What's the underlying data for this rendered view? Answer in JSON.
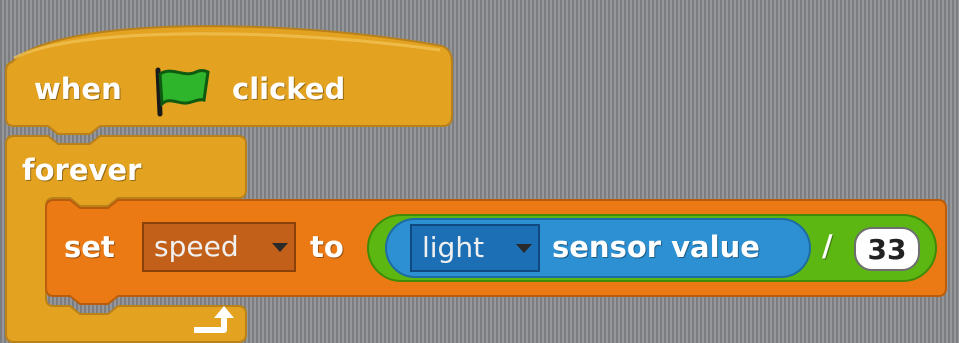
{
  "hat_block": {
    "prefix": "when",
    "icon": "green-flag-icon",
    "suffix": "clicked"
  },
  "forever_block": {
    "label": "forever",
    "loop_icon": "loop-arrow-icon"
  },
  "set_block": {
    "keyword": "set",
    "variable": "speed",
    "to_label": "to"
  },
  "sensor_block": {
    "sensor": "light",
    "label": "sensor value"
  },
  "operator_block": {
    "operator": "/",
    "operand": "33"
  },
  "colors": {
    "control": "#e6a822",
    "variables": "#ee7d16",
    "sensing": "#2c90d2",
    "operators": "#5cb712"
  }
}
